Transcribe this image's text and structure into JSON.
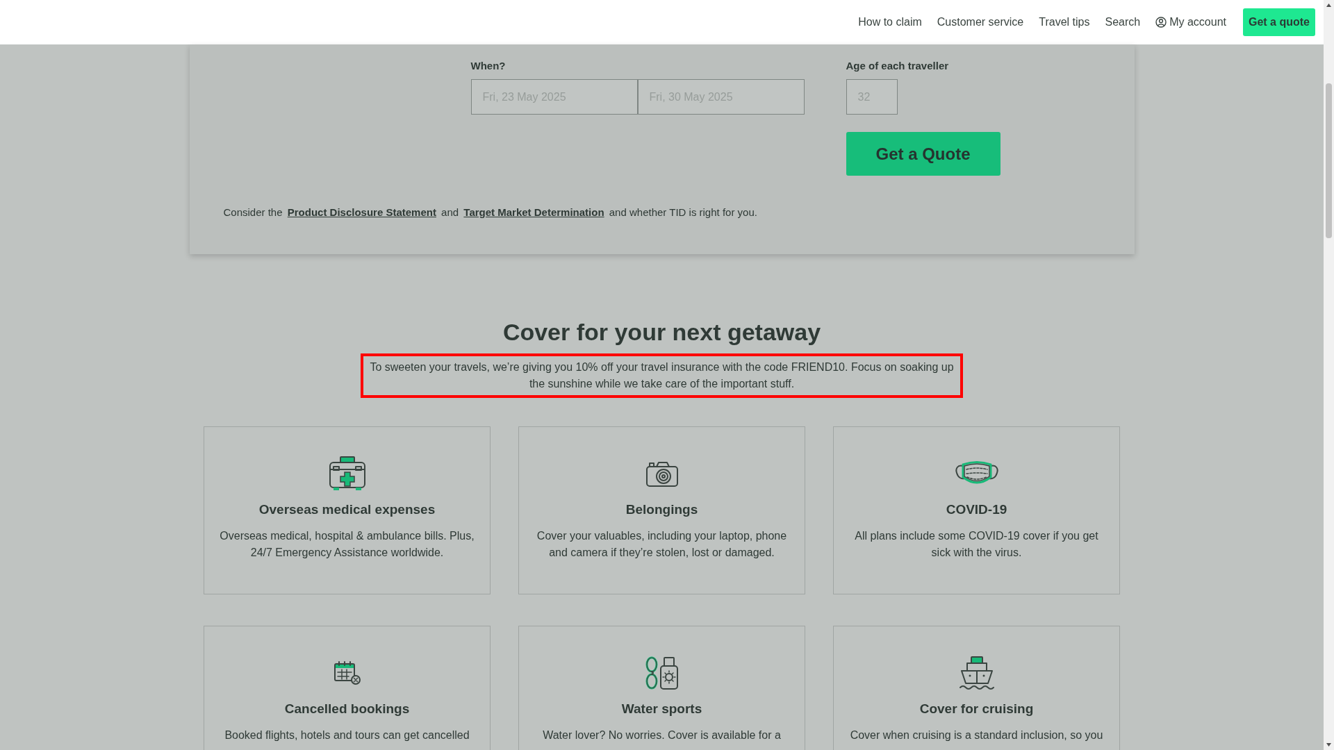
{
  "nav": {
    "links": [
      {
        "label": "How to claim"
      },
      {
        "label": "Customer service"
      },
      {
        "label": "Travel tips"
      },
      {
        "label": "Search"
      }
    ],
    "account": {
      "label": "My account"
    },
    "cta": {
      "label": "Get a quote"
    }
  },
  "quote_form": {
    "when": {
      "label": "When?",
      "start": {
        "placeholder": "Fri, 23 May 2025"
      },
      "end": {
        "placeholder": "Fri, 30 May 2025"
      }
    },
    "age": {
      "label": "Age of each traveller",
      "placeholder": "32"
    },
    "submit": {
      "label": "Get a Quote"
    },
    "disclaimer": [
      {
        "kind": "text",
        "text": "Consider the"
      },
      {
        "kind": "link",
        "text": "Product Disclosure Statement"
      },
      {
        "kind": "text",
        "text": "and"
      },
      {
        "kind": "link",
        "text": "Target Market Determination"
      },
      {
        "kind": "text",
        "text": "and whether TID is right for you."
      }
    ]
  },
  "cover_section": {
    "title": "Cover for your next getaway",
    "promo": {
      "text": "To sweeten your travels, we’re giving you 10% off your travel insurance with the code FRIEND10. Focus on soaking up the sunshine while we take care of the important stuff.",
      "highlighted": true
    },
    "cards": [
      {
        "kind": "medical",
        "title": "Overseas medical expenses",
        "text": "Overseas medical, hospital & ambulance bills. Plus, 24/7 Emergency Assistance worldwide."
      },
      {
        "kind": "camera",
        "title": "Belongings",
        "text": "Cover your valuables, including your laptop, phone and camera if they’re stolen, lost or damaged."
      },
      {
        "kind": "mask",
        "title": "COVID-19",
        "text": "All plans include some COVID-19 cover if you get sick with the virus."
      },
      {
        "kind": "calendar",
        "title": "Cancelled bookings",
        "text": "Booked flights, hotels and tours can get cancelled"
      },
      {
        "kind": "sunscreen",
        "title": "Water sports",
        "text": "Water lover? No worries. Cover is available for a"
      },
      {
        "kind": "ship",
        "title": "Cover for cruising",
        "text": "Cover when cruising is a standard inclusion, so you"
      }
    ]
  }
}
